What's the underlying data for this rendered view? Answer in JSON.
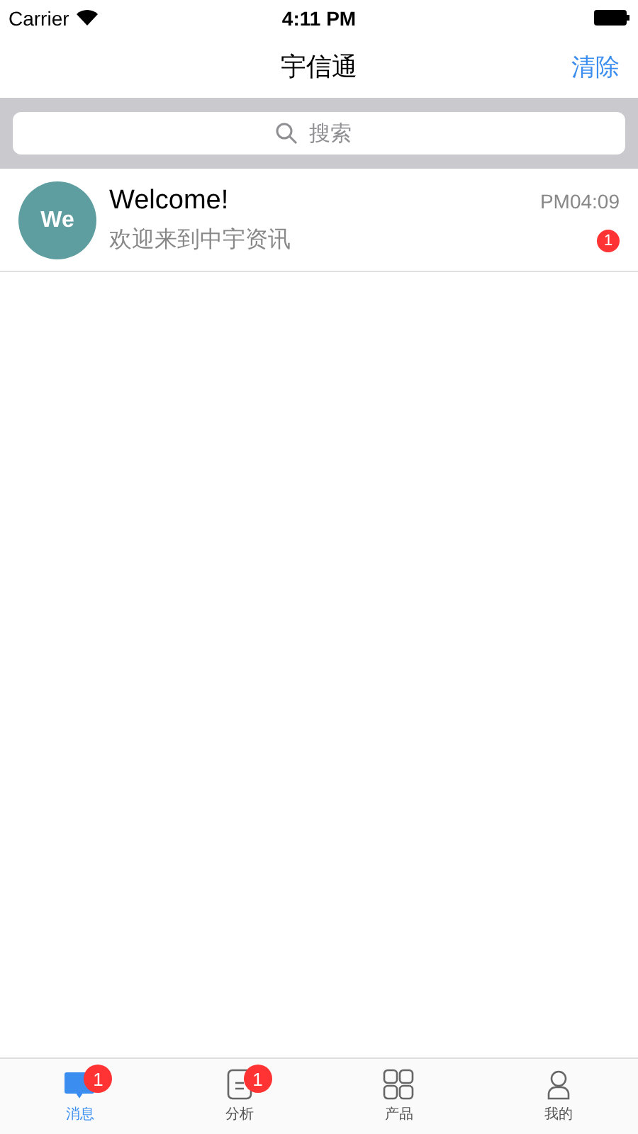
{
  "status_bar": {
    "carrier": "Carrier",
    "time": "4:11 PM"
  },
  "nav": {
    "title": "宇信通",
    "action": "清除"
  },
  "search": {
    "placeholder": "搜索"
  },
  "conversations": [
    {
      "avatar": "We",
      "color": "#5f9ea0",
      "name": "Welcome!",
      "time": "PM04:09",
      "preview": "欢迎来到中宇资讯",
      "unread": "1"
    }
  ],
  "tabs": [
    {
      "kind": "chat",
      "label": "消息",
      "selected": true,
      "badge": "1"
    },
    {
      "kind": "doc",
      "label": "分析",
      "selected": false,
      "badge": "1"
    },
    {
      "kind": "grid",
      "label": "产品",
      "selected": false
    },
    {
      "kind": "person",
      "label": "我的",
      "selected": false
    }
  ]
}
